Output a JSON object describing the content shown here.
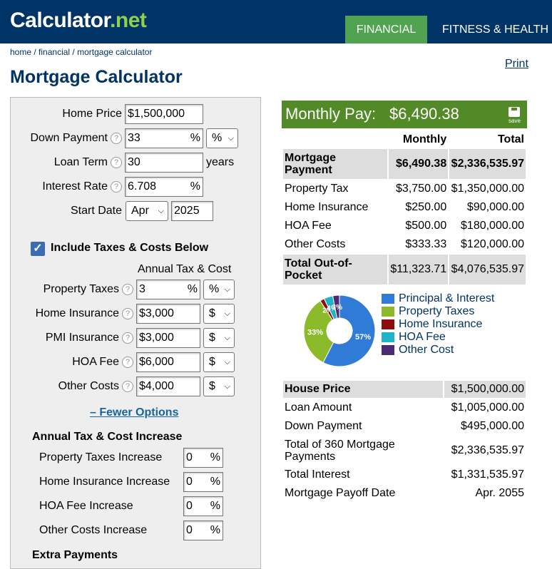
{
  "header": {
    "logo_main": "Calculator",
    "logo_dot": ".",
    "logo_net": "net",
    "nav": [
      "FINANCIAL",
      "FITNESS & HEALTH"
    ]
  },
  "breadcrumb": {
    "home": "home",
    "financial": "financial",
    "current": "mortgage calculator",
    "sep": " / "
  },
  "print_label": "Print",
  "page_title": "Mortgage Calculator",
  "form": {
    "home_price": {
      "label": "Home Price",
      "value": "$1,500,000"
    },
    "down_payment": {
      "label": "Down Payment",
      "value": "33",
      "unit": "%",
      "select": "%"
    },
    "loan_term": {
      "label": "Loan Term",
      "value": "30",
      "suffix": "years"
    },
    "interest_rate": {
      "label": "Interest Rate",
      "value": "6.708",
      "unit": "%"
    },
    "start_date": {
      "label": "Start Date",
      "month": "Apr",
      "year": "2025"
    },
    "include_taxes": {
      "label": "Include Taxes & Costs Below",
      "checked": true
    },
    "annual_header": "Annual Tax & Cost",
    "costs": [
      {
        "label": "Property Taxes",
        "value": "3",
        "unit": "%",
        "select": "%"
      },
      {
        "label": "Home Insurance",
        "value": "$3,000",
        "unit": "",
        "select": "$"
      },
      {
        "label": "PMI Insurance",
        "value": "$3,000",
        "unit": "",
        "select": "$"
      },
      {
        "label": "HOA Fee",
        "value": "$6,000",
        "unit": "",
        "select": "$"
      },
      {
        "label": "Other Costs",
        "value": "$4,000",
        "unit": "",
        "select": "$"
      }
    ],
    "fewer_options": "– Fewer Options",
    "increase_title": "Annual Tax & Cost Increase",
    "increases": [
      {
        "label": "Property Taxes Increase",
        "value": "0",
        "unit": "%"
      },
      {
        "label": "Home Insurance Increase",
        "value": "0",
        "unit": "%"
      },
      {
        "label": "HOA Fee Increase",
        "value": "0",
        "unit": "%"
      },
      {
        "label": "Other Costs Increase",
        "value": "0",
        "unit": "%"
      }
    ],
    "extra_payments": "Extra Payments"
  },
  "results": {
    "monthly_label": "Monthly Pay:",
    "monthly_value": "$6,490.38",
    "save_label": "save",
    "col_monthly": "Monthly",
    "col_total": "Total",
    "rows": [
      {
        "label": "Mortgage Payment",
        "monthly": "$6,490.38",
        "total": "$2,336,535.97"
      },
      {
        "label": "Property Tax",
        "monthly": "$3,750.00",
        "total": "$1,350,000.00"
      },
      {
        "label": "Home Insurance",
        "monthly": "$250.00",
        "total": "$90,000.00"
      },
      {
        "label": "HOA Fee",
        "monthly": "$500.00",
        "total": "$180,000.00"
      },
      {
        "label": "Other Costs",
        "monthly": "$333.33",
        "total": "$120,000.00"
      },
      {
        "label": "Total Out-of-Pocket",
        "monthly": "$11,323.71",
        "total": "$4,076,535.97"
      }
    ],
    "legend": [
      {
        "name": "Principal & Interest",
        "color": "#2f7bd5"
      },
      {
        "name": "Property Taxes",
        "color": "#8bbb2a"
      },
      {
        "name": "Home Insurance",
        "color": "#8b0e0e"
      },
      {
        "name": "HOA Fee",
        "color": "#1fb2c9"
      },
      {
        "name": "Other Cost",
        "color": "#4b2b73"
      }
    ],
    "pie": [
      {
        "label": "57%",
        "value": 57
      },
      {
        "label": "33%",
        "value": 33
      },
      {
        "label": "2%",
        "value": 2
      },
      {
        "label": "4%",
        "value": 4
      },
      {
        "label": "3%",
        "value": 3
      }
    ],
    "summary": [
      {
        "label": "House Price",
        "value": "$1,500,000.00"
      },
      {
        "label": "Loan Amount",
        "value": "$1,005,000.00"
      },
      {
        "label": "Down Payment",
        "value": "$495,000.00"
      },
      {
        "label": "Total of 360 Mortgage Payments",
        "value": "$2,336,535.97"
      },
      {
        "label": "Total Interest",
        "value": "$1,331,535.97"
      },
      {
        "label": "Mortgage Payoff Date",
        "value": "Apr. 2055"
      }
    ]
  }
}
